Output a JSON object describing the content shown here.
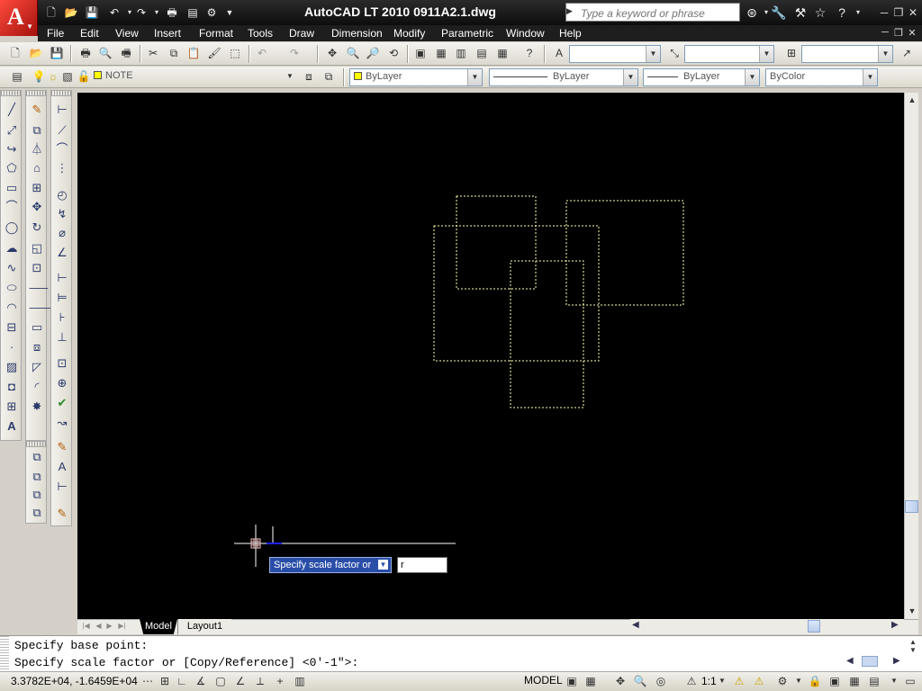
{
  "app": {
    "title": "AutoCAD LT 2010     0911A2.1.dwg",
    "logo_letter": "A"
  },
  "search": {
    "placeholder": "Type a keyword or phrase"
  },
  "menu": [
    "File",
    "Edit",
    "View",
    "Insert",
    "Format",
    "Tools",
    "Draw",
    "Dimension",
    "Modify",
    "Parametric",
    "Window",
    "Help"
  ],
  "layers": {
    "current_layer": "NOTE",
    "color": "ByLayer",
    "linetype": "ByLayer",
    "lineweight": "ByLayer",
    "plotstyle": "ByColor"
  },
  "tooltip": {
    "prompt": "Specify scale factor or",
    "input_value": "r"
  },
  "tabs": {
    "model": "Model",
    "layout1": "Layout1"
  },
  "command": {
    "line1": "Specify base point:",
    "line2": "Specify scale factor or [Copy/Reference] <0'-1\">:"
  },
  "status": {
    "coords": "3.3782E+04,  -1.6459E+04",
    "model_label": "MODEL",
    "annotation_scale": "1:1"
  },
  "colors": {
    "canvas": "#000000",
    "dashed_lines": "#ffffaa",
    "title_bg": "#1a1a1a",
    "logo": "#d9261c"
  }
}
